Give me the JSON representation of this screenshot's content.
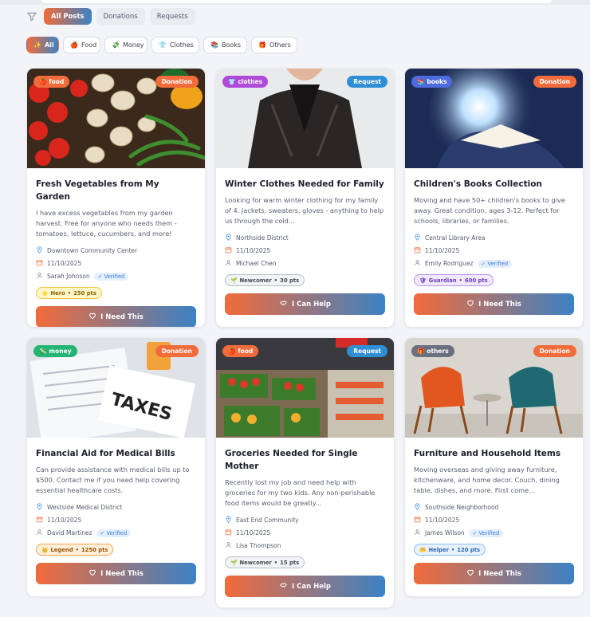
{
  "post_filter": {
    "tabs": [
      "All Posts",
      "Donations",
      "Requests"
    ],
    "active": "All Posts"
  },
  "categories": [
    {
      "label": "All",
      "icon": "sparkles-icon",
      "glyph": "✨"
    },
    {
      "label": "Food",
      "icon": "food-icon",
      "glyph": "🍎"
    },
    {
      "label": "Money",
      "icon": "money-icon",
      "glyph": "💸"
    },
    {
      "label": "Clothes",
      "icon": "shirt-icon",
      "glyph": "👕"
    },
    {
      "label": "Books",
      "icon": "books-icon",
      "glyph": "📚"
    },
    {
      "label": "Others",
      "icon": "gift-icon",
      "glyph": "🎁"
    }
  ],
  "colors": {
    "accent_start": "#f26b3a",
    "accent_end": "#3b82c4",
    "donation": "#f26b3a",
    "request": "#2f8fd6"
  },
  "posts": [
    {
      "category": "food",
      "category_glyph": "🍎",
      "category_color": "#f26b3a",
      "type": "Donation",
      "type_color": "#f26b3a",
      "title": "Fresh Vegetables from My Garden",
      "description": "I have excess vegetables from my garden harvest. Free for anyone who needs them - tomatoes, lettuce, cucumbers, and more!",
      "location": "Downtown Community Center",
      "date": "11/10/2025",
      "user": "Sarah Johnson",
      "verified": "✓ Verified",
      "level": "Hero",
      "level_glyph": "⭐",
      "points": "250 pts",
      "level_bg": "#fff6c9",
      "level_border": "#f0c93a",
      "level_color": "#8a6100",
      "button": "I Need This",
      "button_icon": "heart-icon"
    },
    {
      "category": "clothes",
      "category_glyph": "👕",
      "category_color": "#b04ad8",
      "type": "Request",
      "type_color": "#2f8fd6",
      "title": "Winter Clothes Needed for Family",
      "description": "Looking for warm winter clothing for my family of 4. Jackets, sweaters, gloves - anything to help us through the cold...",
      "location": "Northside District",
      "date": "11/10/2025",
      "user": "Michael Chen",
      "verified": "",
      "level": "Newcomer",
      "level_glyph": "🌱",
      "points": "30 pts",
      "level_bg": "#f2f3f5",
      "level_border": "#b9bdc6",
      "level_color": "#444a57",
      "button": "I Can Help",
      "button_icon": "handshake-icon"
    },
    {
      "category": "books",
      "category_glyph": "📚",
      "category_color": "#4f6be0",
      "type": "Donation",
      "type_color": "#f26b3a",
      "title": "Children's Books Collection",
      "description": "Moving and have 50+ children's books to give away. Great condition, ages 3-12. Perfect for schools, libraries, or families.",
      "location": "Central Library Area",
      "date": "11/10/2025",
      "user": "Emily Rodriguez",
      "verified": "✓ Verified",
      "level": "Guardian",
      "level_glyph": "🛡",
      "points": "600 pts",
      "level_bg": "#f1e9ff",
      "level_border": "#b892f0",
      "level_color": "#6a3fbf",
      "button": "I Need This",
      "button_icon": "heart-icon"
    },
    {
      "category": "money",
      "category_glyph": "💸",
      "category_color": "#22b573",
      "type": "Donation",
      "type_color": "#f26b3a",
      "title": "Financial Aid for Medical Bills",
      "description": "Can provide assistance with medical bills up to $500. Contact me if you need help covering essential healthcare costs.",
      "location": "Westside Medical District",
      "date": "11/10/2025",
      "user": "David Martinez",
      "verified": "✓ Verified",
      "level": "Legend",
      "level_glyph": "👑",
      "points": "1250 pts",
      "level_bg": "#fff0dc",
      "level_border": "#f2a64b",
      "level_color": "#9a5300",
      "button": "I Need This",
      "button_icon": "heart-icon"
    },
    {
      "category": "food",
      "category_glyph": "🍎",
      "category_color": "#f26b3a",
      "type": "Request",
      "type_color": "#2f8fd6",
      "title": "Groceries Needed for Single Mother",
      "description": "Recently lost my job and need help with groceries for my two kids. Any non-perishable food items would be greatly...",
      "location": "East End Community",
      "date": "11/10/2025",
      "user": "Lisa Thompson",
      "verified": "",
      "level": "Newcomer",
      "level_glyph": "🌱",
      "points": "15 pts",
      "level_bg": "#f2f3f5",
      "level_border": "#b9bdc6",
      "level_color": "#444a57",
      "button": "I Can Help",
      "button_icon": "handshake-icon"
    },
    {
      "category": "others",
      "category_glyph": "🎁",
      "category_color": "#6b7080",
      "type": "Donation",
      "type_color": "#f26b3a",
      "title": "Furniture and Household Items",
      "description": "Moving overseas and giving away furniture, kitchenware, and home decor. Couch, dining table, dishes, and more. First come...",
      "location": "Southside Neighborhood",
      "date": "11/10/2025",
      "user": "James Wilson",
      "verified": "✓ Verified",
      "level": "Helper",
      "level_glyph": "🤲",
      "points": "120 pts",
      "level_bg": "#e6f2ff",
      "level_border": "#8cbcf0",
      "level_color": "#2d66b0",
      "button": "I Need This",
      "button_icon": "heart-icon"
    }
  ]
}
